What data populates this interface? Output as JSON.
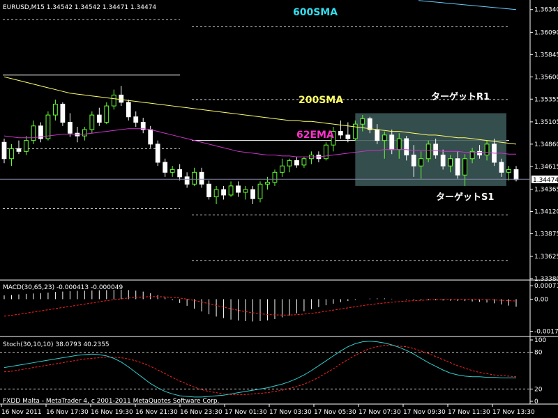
{
  "header": {
    "symbol_line": "EURUSD,M15  1.34542 1.34542 1.34471 1.34474",
    "footer_text": "FXDD Malta - MetaTrader 4, c 2001-2011 MetaQuotes Software Corp."
  },
  "annotations": {
    "sma600": "600SMA",
    "sma200": "200SMA",
    "ema62": "62EMA",
    "target_r1": "ターゲットR1",
    "target_s1": "ターゲットS1"
  },
  "colors": {
    "background": "#000000",
    "grid_frame": "#ffffff",
    "bull_candle": "#66ff33",
    "bear_candle": "#ffffff",
    "sma200": "#ffff66",
    "ema62": "#cc33cc",
    "sma600": "#66ccff",
    "macd_signal": "#ff2222",
    "stoch_main": "#33cccc",
    "stoch_signal": "#ff2222",
    "range_box": "#4a6a6a",
    "current_line": "#8888aa"
  },
  "chart_data": [
    {
      "type": "line",
      "name": "price",
      "current_price_label": "1.34474",
      "ylim": [
        1.3338,
        1.3643
      ],
      "ytick_labels": [
        "1.36340",
        "1.36090",
        "1.35845",
        "1.35600",
        "1.35355",
        "1.35105",
        "1.34860",
        "1.34615",
        "1.34365",
        "1.34120",
        "1.33875",
        "1.33625",
        "1.33380"
      ],
      "xtick_labels": [
        "16 Nov 2011",
        "16 Nov 17:30",
        "16 Nov 19:30",
        "16 Nov 21:30",
        "16 Nov 23:30",
        "17 Nov 01:30",
        "17 Nov 03:30",
        "17 Nov 05:30",
        "17 Nov 07:30",
        "17 Nov 09:30",
        "17 Nov 11:30",
        "17 Nov 13:30"
      ],
      "candles_ohlc": [
        [
          1.3488,
          1.3492,
          1.3465,
          1.347
        ],
        [
          1.347,
          1.3486,
          1.3462,
          1.3481
        ],
        [
          1.3481,
          1.349,
          1.3475,
          1.3478
        ],
        [
          1.3478,
          1.3495,
          1.3474,
          1.349
        ],
        [
          1.349,
          1.3512,
          1.3486,
          1.3506
        ],
        [
          1.3506,
          1.351,
          1.3488,
          1.3492
        ],
        [
          1.3492,
          1.3522,
          1.349,
          1.3518
        ],
        [
          1.3518,
          1.3535,
          1.3512,
          1.353
        ],
        [
          1.353,
          1.3532,
          1.3506,
          1.351
        ],
        [
          1.351,
          1.352,
          1.3494,
          1.3498
        ],
        [
          1.3498,
          1.3505,
          1.3488,
          1.3495
        ],
        [
          1.3495,
          1.3505,
          1.349,
          1.3502
        ],
        [
          1.3502,
          1.3522,
          1.3498,
          1.3518
        ],
        [
          1.3518,
          1.3526,
          1.3506,
          1.351
        ],
        [
          1.351,
          1.3532,
          1.3508,
          1.3528
        ],
        [
          1.3528,
          1.3546,
          1.3524,
          1.354
        ],
        [
          1.354,
          1.355,
          1.3528,
          1.3532
        ],
        [
          1.3532,
          1.3535,
          1.3512,
          1.3516
        ],
        [
          1.3516,
          1.3522,
          1.3505,
          1.351
        ],
        [
          1.351,
          1.3515,
          1.3498,
          1.3502
        ],
        [
          1.3502,
          1.3506,
          1.3482,
          1.3486
        ],
        [
          1.3486,
          1.349,
          1.3462,
          1.3466
        ],
        [
          1.3466,
          1.347,
          1.345,
          1.3455
        ],
        [
          1.3455,
          1.3462,
          1.345,
          1.3458
        ],
        [
          1.3458,
          1.3464,
          1.3446,
          1.345
        ],
        [
          1.345,
          1.3455,
          1.3438,
          1.3442
        ],
        [
          1.3442,
          1.346,
          1.344,
          1.3455
        ],
        [
          1.3455,
          1.346,
          1.3438,
          1.3442
        ],
        [
          1.3442,
          1.3446,
          1.3425,
          1.3428
        ],
        [
          1.3428,
          1.344,
          1.342,
          1.3436
        ],
        [
          1.3436,
          1.344,
          1.3425,
          1.343
        ],
        [
          1.343,
          1.3445,
          1.3428,
          1.344
        ],
        [
          1.344,
          1.3445,
          1.3428,
          1.3433
        ],
        [
          1.3433,
          1.344,
          1.3425,
          1.3436
        ],
        [
          1.3436,
          1.344,
          1.342,
          1.3426
        ],
        [
          1.3426,
          1.3445,
          1.3422,
          1.3442
        ],
        [
          1.3442,
          1.345,
          1.3436,
          1.3444
        ],
        [
          1.3444,
          1.3458,
          1.344,
          1.3455
        ],
        [
          1.3455,
          1.347,
          1.345,
          1.3462
        ],
        [
          1.3462,
          1.347,
          1.3455,
          1.3468
        ],
        [
          1.3468,
          1.3472,
          1.346,
          1.3463
        ],
        [
          1.3463,
          1.3472,
          1.346,
          1.347
        ],
        [
          1.347,
          1.3478,
          1.3464,
          1.3474
        ],
        [
          1.3474,
          1.3478,
          1.3466,
          1.347
        ],
        [
          1.347,
          1.3488,
          1.3468,
          1.3485
        ],
        [
          1.3485,
          1.3505,
          1.3478,
          1.35
        ],
        [
          1.35,
          1.3512,
          1.3492,
          1.3496
        ],
        [
          1.3496,
          1.351,
          1.3488,
          1.3492
        ],
        [
          1.3492,
          1.3512,
          1.349,
          1.3508
        ],
        [
          1.3508,
          1.3518,
          1.35,
          1.3514
        ],
        [
          1.3514,
          1.3516,
          1.3498,
          1.3502
        ],
        [
          1.3502,
          1.3508,
          1.3486,
          1.349
        ],
        [
          1.349,
          1.35,
          1.347,
          1.3496
        ],
        [
          1.3496,
          1.3502,
          1.3475,
          1.348
        ],
        [
          1.348,
          1.3498,
          1.347,
          1.3492
        ],
        [
          1.3492,
          1.3495,
          1.3468,
          1.3474
        ],
        [
          1.3474,
          1.3485,
          1.345,
          1.3462
        ],
        [
          1.3462,
          1.3478,
          1.3448,
          1.347
        ],
        [
          1.347,
          1.349,
          1.3466,
          1.3486
        ],
        [
          1.3486,
          1.3492,
          1.347,
          1.3474
        ],
        [
          1.3474,
          1.348,
          1.3458,
          1.3462
        ],
        [
          1.3462,
          1.3474,
          1.3455,
          1.347
        ],
        [
          1.347,
          1.3478,
          1.3448,
          1.3452
        ],
        [
          1.3452,
          1.3475,
          1.344,
          1.347
        ],
        [
          1.347,
          1.3482,
          1.3465,
          1.3478
        ],
        [
          1.3478,
          1.3485,
          1.347,
          1.3474
        ],
        [
          1.3474,
          1.349,
          1.3468,
          1.3486
        ],
        [
          1.3486,
          1.3492,
          1.3462,
          1.3466
        ],
        [
          1.3466,
          1.347,
          1.345,
          1.3455
        ],
        [
          1.3455,
          1.3462,
          1.3446,
          1.3458
        ],
        [
          1.3458,
          1.3462,
          1.3445,
          1.3447
        ]
      ],
      "sma200": [
        1.356,
        1.3558,
        1.3556,
        1.3554,
        1.3552,
        1.355,
        1.3548,
        1.3546,
        1.3544,
        1.3542,
        1.3541,
        1.354,
        1.3539,
        1.3538,
        1.3537,
        1.3536,
        1.3535,
        1.3534,
        1.3533,
        1.3532,
        1.3531,
        1.353,
        1.3529,
        1.3528,
        1.3527,
        1.3526,
        1.3525,
        1.3524,
        1.3523,
        1.3522,
        1.3521,
        1.352,
        1.3519,
        1.3518,
        1.3517,
        1.3516,
        1.3515,
        1.3514,
        1.3513,
        1.3512,
        1.3512,
        1.3511,
        1.3511,
        1.351,
        1.3509,
        1.3508,
        1.3507,
        1.3506,
        1.3505,
        1.3504,
        1.3503,
        1.3502,
        1.3501,
        1.35,
        1.35,
        1.3499,
        1.3498,
        1.3497,
        1.3496,
        1.3496,
        1.3495,
        1.3494,
        1.3493,
        1.3493,
        1.3492,
        1.3491,
        1.349,
        1.3489,
        1.3488,
        1.3487,
        1.3486
      ],
      "ema62": [
        1.3495,
        1.3494,
        1.3493,
        1.3493,
        1.3493,
        1.3494,
        1.3495,
        1.3496,
        1.3497,
        1.3497,
        1.3497,
        1.3497,
        1.3498,
        1.3499,
        1.35,
        1.3501,
        1.3502,
        1.3503,
        1.3503,
        1.3503,
        1.3502,
        1.35,
        1.3498,
        1.3496,
        1.3494,
        1.3492,
        1.349,
        1.3488,
        1.3486,
        1.3484,
        1.3482,
        1.348,
        1.3478,
        1.3477,
        1.3476,
        1.3475,
        1.3474,
        1.3474,
        1.3473,
        1.3473,
        1.3472,
        1.3472,
        1.3472,
        1.3472,
        1.3473,
        1.3474,
        1.3475,
        1.3476,
        1.3477,
        1.3478,
        1.3479,
        1.3479,
        1.348,
        1.348,
        1.348,
        1.348,
        1.3479,
        1.3479,
        1.3479,
        1.3479,
        1.3478,
        1.3478,
        1.3478,
        1.3477,
        1.3477,
        1.3477,
        1.3477,
        1.3476,
        1.3476,
        1.3475,
        1.3475
      ],
      "sma600_line": [
        1.3644,
        1.3634
      ],
      "target_r1_level": 1.3535,
      "target_s1_level": 1.3408
    },
    {
      "type": "bar",
      "name": "MACD",
      "title": "MACD(30,65,23) -0.000413 -0.000049",
      "ytick_labels": [
        "0.000712",
        "0.00",
        "-0.001703"
      ],
      "ylim": [
        -0.0019,
        0.0009
      ],
      "histogram": [
        0.0002,
        0.00022,
        0.00025,
        0.00028,
        0.0003,
        0.00032,
        0.00035,
        0.00038,
        0.0004,
        0.00042,
        0.00044,
        0.00045,
        0.00046,
        0.00047,
        0.00048,
        0.00049,
        0.0005,
        0.00048,
        0.00045,
        0.0004,
        0.00032,
        0.00022,
        0.0001,
        -5e-05,
        -0.0002,
        -0.00035,
        -0.0005,
        -0.00065,
        -0.0008,
        -0.00092,
        -0.001,
        -0.00108,
        -0.00113,
        -0.00116,
        -0.00118,
        -0.00116,
        -0.00112,
        -0.00105,
        -0.00096,
        -0.00086,
        -0.00075,
        -0.00064,
        -0.00053,
        -0.00042,
        -0.00032,
        -0.00024,
        -0.00016,
        -0.0001,
        -4e-05,
        0.0,
        3e-05,
        4e-05,
        4e-05,
        2e-05,
        0.0,
        -2e-05,
        -4e-05,
        -5e-05,
        -6e-05,
        -6e-05,
        -7e-05,
        -8e-05,
        -9e-05,
        -0.0001,
        -0.00012,
        -0.00014,
        -0.00018,
        -0.00022,
        -0.00028,
        -0.00034,
        -0.0004
      ],
      "signal": [
        -0.0009,
        -0.00085,
        -0.0008,
        -0.00074,
        -0.00068,
        -0.00062,
        -0.00056,
        -0.0005,
        -0.00044,
        -0.00038,
        -0.00032,
        -0.00026,
        -0.0002,
        -0.00014,
        -8e-05,
        -3e-05,
        2e-05,
        6e-05,
        0.0001,
        0.00012,
        0.00013,
        0.00013,
        0.00012,
        0.0001,
        6e-05,
        0.0,
        -7e-05,
        -0.00015,
        -0.00024,
        -0.00033,
        -0.00042,
        -0.00051,
        -0.00059,
        -0.00066,
        -0.00072,
        -0.00077,
        -0.00081,
        -0.00083,
        -0.00084,
        -0.00084,
        -0.00082,
        -0.00079,
        -0.00075,
        -0.0007,
        -0.00064,
        -0.00058,
        -0.00052,
        -0.00046,
        -0.0004,
        -0.00034,
        -0.00029,
        -0.00024,
        -0.0002,
        -0.00016,
        -0.00013,
        -0.0001,
        -8e-05,
        -6e-05,
        -4e-05,
        -3e-05,
        -2e-05,
        -2e-05,
        -1e-05,
        -1e-05,
        -1e-05,
        -2e-05,
        -3e-05,
        -4e-05,
        -6e-05,
        -8e-05,
        -0.0001
      ]
    },
    {
      "type": "line",
      "name": "Stoch",
      "title": "Stoch(30,10,10) 38.0793 40.2355",
      "ytick_labels": [
        "100",
        "80",
        "20",
        "0"
      ],
      "ylim": [
        0,
        100
      ],
      "main": [
        55,
        57,
        59,
        61,
        63,
        65,
        67,
        69,
        71,
        73,
        75,
        76,
        77,
        76,
        74,
        70,
        64,
        56,
        47,
        38,
        29,
        22,
        16,
        12,
        9,
        8,
        7,
        7,
        8,
        9,
        10,
        12,
        14,
        16,
        18,
        20,
        22,
        25,
        28,
        32,
        37,
        43,
        50,
        58,
        66,
        74,
        82,
        89,
        94,
        97,
        98,
        97,
        95,
        92,
        88,
        83,
        77,
        70,
        63,
        57,
        51,
        46,
        43,
        41,
        40,
        40,
        39,
        39,
        38,
        38,
        38
      ],
      "signal": [
        48,
        49,
        51,
        53,
        55,
        57,
        59,
        61,
        63,
        65,
        67,
        69,
        70,
        71,
        72,
        72,
        71,
        69,
        66,
        62,
        57,
        51,
        45,
        39,
        33,
        28,
        23,
        19,
        16,
        14,
        12,
        11,
        11,
        11,
        12,
        13,
        14,
        16,
        18,
        21,
        24,
        28,
        33,
        39,
        46,
        53,
        61,
        68,
        75,
        81,
        86,
        89,
        91,
        91,
        90,
        89,
        86,
        82,
        78,
        73,
        68,
        63,
        58,
        54,
        50,
        47,
        45,
        43,
        42,
        41,
        40
      ]
    }
  ]
}
